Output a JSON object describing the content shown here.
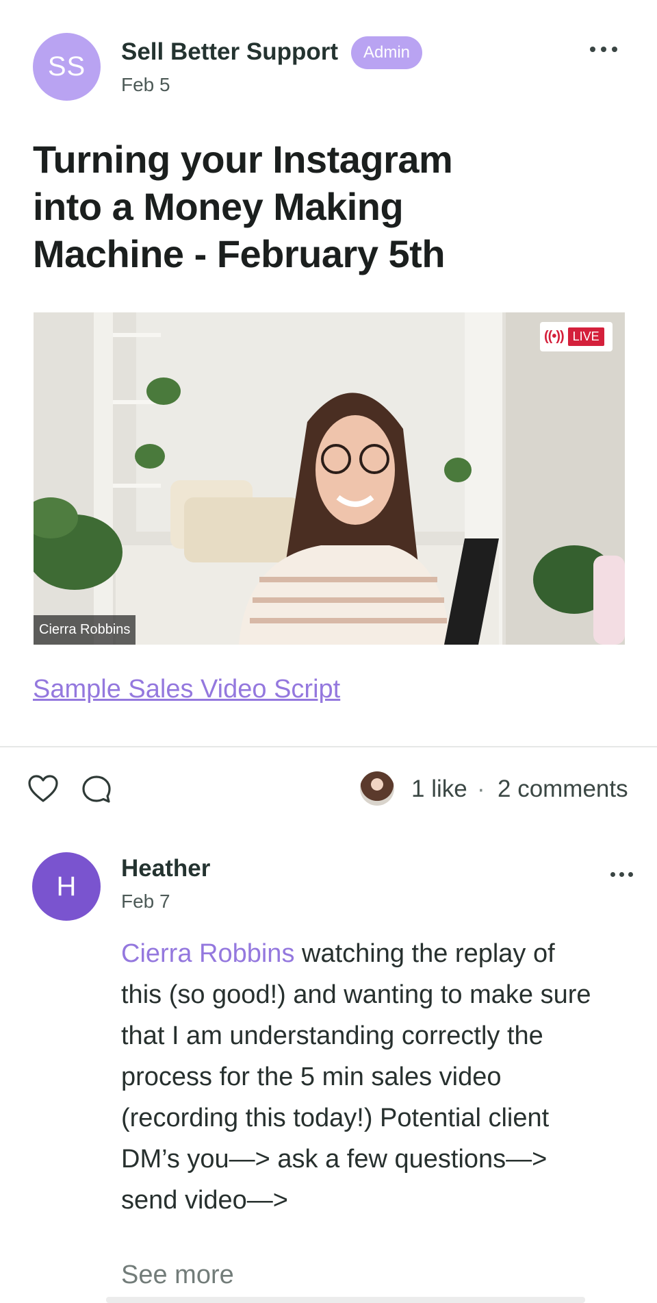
{
  "post": {
    "author_initials": "SS",
    "author_name": "Sell Better Support",
    "badge": "Admin",
    "date": "Feb 5",
    "title": "Turning your Instagram into a Money Making Machine - February 5th",
    "video": {
      "live_label": "LIVE",
      "live_icon": "((•))",
      "speaker_name": "Cierra Robbins"
    },
    "link_text": "Sample Sales Video Script"
  },
  "engagement": {
    "likes": "1 like",
    "separator": "·",
    "comments": "2 comments"
  },
  "comment": {
    "author_initial": "H",
    "author_name": "Heather",
    "date": "Feb 7",
    "mention": "Cierra Robbins",
    "body": " watching the replay of this (so good!) and wanting to make sure that I am understanding correctly the process for the 5 min sales video (recording this today!) Potential client DM’s you—> ask a few questions—> send video—>",
    "see_more": "See more"
  },
  "colors": {
    "accent": "#9478de",
    "badge_bg": "#b9a3f2",
    "comment_avatar": "#7a54cf",
    "live_red": "#d4203b"
  },
  "icons": [
    "more-horizontal-icon",
    "heart-icon",
    "comment-icon",
    "live-broadcast-icon"
  ]
}
